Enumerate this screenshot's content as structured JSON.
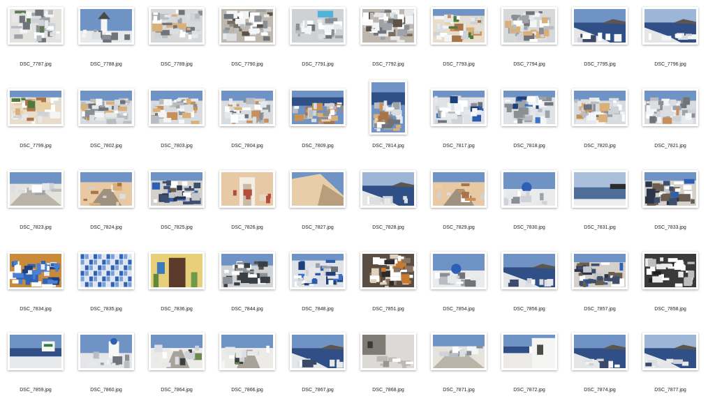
{
  "window": {
    "view": "icon-grid"
  },
  "colors": {
    "background": "#ffffff",
    "label_text": "#222222",
    "sky": "#6f93c4",
    "sea": "#2f4f86",
    "whitewash": "#eef0f2",
    "stone": "#c9b8a2"
  },
  "rows": [
    {
      "items": [
        {
          "name": "DSC_7787.jpg",
          "orientation": "landscape",
          "scene": "town-stairs"
        },
        {
          "name": "DSC_7788.jpg",
          "orientation": "landscape",
          "scene": "windmill"
        },
        {
          "name": "DSC_7789.jpg",
          "orientation": "landscape",
          "scene": "town"
        },
        {
          "name": "DSC_7790.jpg",
          "orientation": "landscape",
          "scene": "town-dark"
        },
        {
          "name": "DSC_7791.jpg",
          "orientation": "landscape",
          "scene": "town-pool"
        },
        {
          "name": "DSC_7792.jpg",
          "orientation": "landscape",
          "scene": "town-dark"
        },
        {
          "name": "DSC_7793.jpg",
          "orientation": "landscape",
          "scene": "town-warm"
        },
        {
          "name": "DSC_7794.jpg",
          "orientation": "landscape",
          "scene": "town"
        },
        {
          "name": "DSC_7795.jpg",
          "orientation": "landscape",
          "scene": "caldera"
        },
        {
          "name": "DSC_7796.jpg",
          "orientation": "landscape",
          "scene": "caldera-bright"
        }
      ]
    },
    {
      "items": [
        {
          "name": "DSC_7799.jpg",
          "orientation": "landscape",
          "scene": "town-warm"
        },
        {
          "name": "DSC_7802.jpg",
          "orientation": "landscape",
          "scene": "town-sky"
        },
        {
          "name": "DSC_7803.jpg",
          "orientation": "landscape",
          "scene": "town-sky"
        },
        {
          "name": "DSC_7804.jpg",
          "orientation": "landscape",
          "scene": "town-sky"
        },
        {
          "name": "DSC_7809.jpg",
          "orientation": "landscape",
          "scene": "town-sea"
        },
        {
          "name": "DSC_7814.jpg",
          "orientation": "portrait",
          "scene": "town-sea"
        },
        {
          "name": "DSC_7817.jpg",
          "orientation": "landscape",
          "scene": "town-dome"
        },
        {
          "name": "DSC_7818.jpg",
          "orientation": "landscape",
          "scene": "town-dome"
        },
        {
          "name": "DSC_7820.jpg",
          "orientation": "landscape",
          "scene": "town-sky"
        },
        {
          "name": "DSC_7821.jpg",
          "orientation": "landscape",
          "scene": "town-sky"
        }
      ]
    },
    {
      "items": [
        {
          "name": "DSC_7823.jpg",
          "orientation": "landscape",
          "scene": "alley"
        },
        {
          "name": "DSC_7824.jpg",
          "orientation": "landscape",
          "scene": "alley-warm"
        },
        {
          "name": "DSC_7825.jpg",
          "orientation": "landscape",
          "scene": "alley-shop"
        },
        {
          "name": "DSC_7826.jpg",
          "orientation": "landscape",
          "scene": "arch"
        },
        {
          "name": "DSC_7827.jpg",
          "orientation": "landscape",
          "scene": "wall-sky"
        },
        {
          "name": "DSC_7828.jpg",
          "orientation": "landscape",
          "scene": "caldera-bright"
        },
        {
          "name": "DSC_7829.jpg",
          "orientation": "landscape",
          "scene": "alley-warm"
        },
        {
          "name": "DSC_7830.jpg",
          "orientation": "landscape",
          "scene": "dome-sea"
        },
        {
          "name": "DSC_7831.jpg",
          "orientation": "landscape",
          "scene": "sea-calm"
        },
        {
          "name": "DSC_7833.jpg",
          "orientation": "landscape",
          "scene": "alley-shop"
        }
      ]
    },
    {
      "items": [
        {
          "name": "DSC_7834.jpg",
          "orientation": "landscape",
          "scene": "souvenirs"
        },
        {
          "name": "DSC_7835.jpg",
          "orientation": "landscape",
          "scene": "magnets"
        },
        {
          "name": "DSC_7836.jpg",
          "orientation": "landscape",
          "scene": "door"
        },
        {
          "name": "DSC_7844.jpg",
          "orientation": "landscape",
          "scene": "alley-dark"
        },
        {
          "name": "DSC_7848.jpg",
          "orientation": "landscape",
          "scene": "town-dome"
        },
        {
          "name": "DSC_7851.jpg",
          "orientation": "landscape",
          "scene": "shop-dark"
        },
        {
          "name": "DSC_7854.jpg",
          "orientation": "landscape",
          "scene": "dome-sea"
        },
        {
          "name": "DSC_7856.jpg",
          "orientation": "landscape",
          "scene": "caldera"
        },
        {
          "name": "DSC_7857.jpg",
          "orientation": "landscape",
          "scene": "alley-shop"
        },
        {
          "name": "DSC_7858.jpg",
          "orientation": "landscape",
          "scene": "hats"
        }
      ]
    },
    {
      "items": [
        {
          "name": "DSC_7859.jpg",
          "orientation": "landscape",
          "scene": "sign-sea"
        },
        {
          "name": "DSC_7860.jpg",
          "orientation": "landscape",
          "scene": "church-sky"
        },
        {
          "name": "DSC_7864.jpg",
          "orientation": "landscape",
          "scene": "alley-sky"
        },
        {
          "name": "DSC_7866.jpg",
          "orientation": "landscape",
          "scene": "alley-sky"
        },
        {
          "name": "DSC_7867.jpg",
          "orientation": "landscape",
          "scene": "caldera"
        },
        {
          "name": "DSC_7868.jpg",
          "orientation": "landscape",
          "scene": "wall-shadow"
        },
        {
          "name": "DSC_7871.jpg",
          "orientation": "landscape",
          "scene": "alley"
        },
        {
          "name": "DSC_7872.jpg",
          "orientation": "landscape",
          "scene": "alley-sea"
        },
        {
          "name": "DSC_7874.jpg",
          "orientation": "landscape",
          "scene": "caldera"
        },
        {
          "name": "DSC_7877.jpg",
          "orientation": "landscape",
          "scene": "caldera-bright"
        }
      ]
    }
  ]
}
